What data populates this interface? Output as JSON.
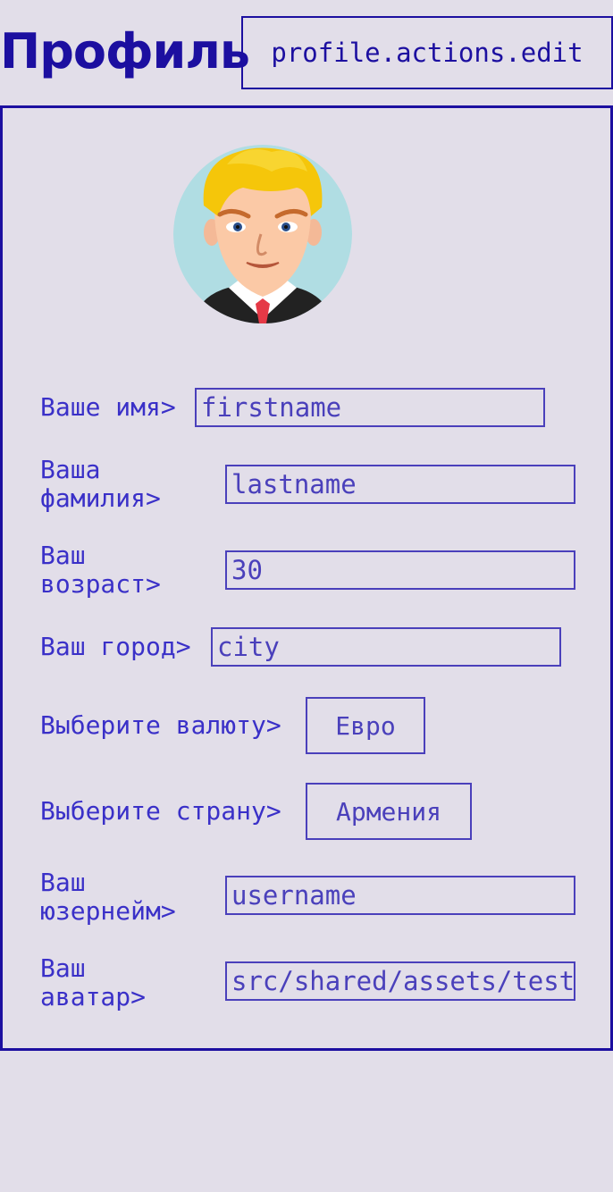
{
  "header": {
    "title": "Профиль",
    "edit_button_label": "profile.actions.edit"
  },
  "colors": {
    "background": "#e2dee9",
    "primary": "#1c0fa0",
    "text": "#3a30c8"
  },
  "profile": {
    "avatar_icon": "avatar-icon",
    "fields": {
      "firstname": {
        "label": "Ваше имя>",
        "value": "firstname"
      },
      "lastname": {
        "label_line1": "Ваша",
        "label_line2": "фамилия>",
        "value": "lastname"
      },
      "age": {
        "label_line1": "Ваш",
        "label_line2": "возраст>",
        "value": "30"
      },
      "city": {
        "label": "Ваш город>",
        "value": "city"
      },
      "currency": {
        "label": "Выберите валюту>",
        "value": "Евро"
      },
      "country": {
        "label": "Выберите страну>",
        "value": "Армения"
      },
      "username": {
        "label_line1": "Ваш",
        "label_line2": "юзернейм>",
        "value": "username"
      },
      "avatar": {
        "label_line1": "Ваш",
        "label_line2": "аватар>",
        "value": "src/shared/assets/test"
      }
    }
  }
}
